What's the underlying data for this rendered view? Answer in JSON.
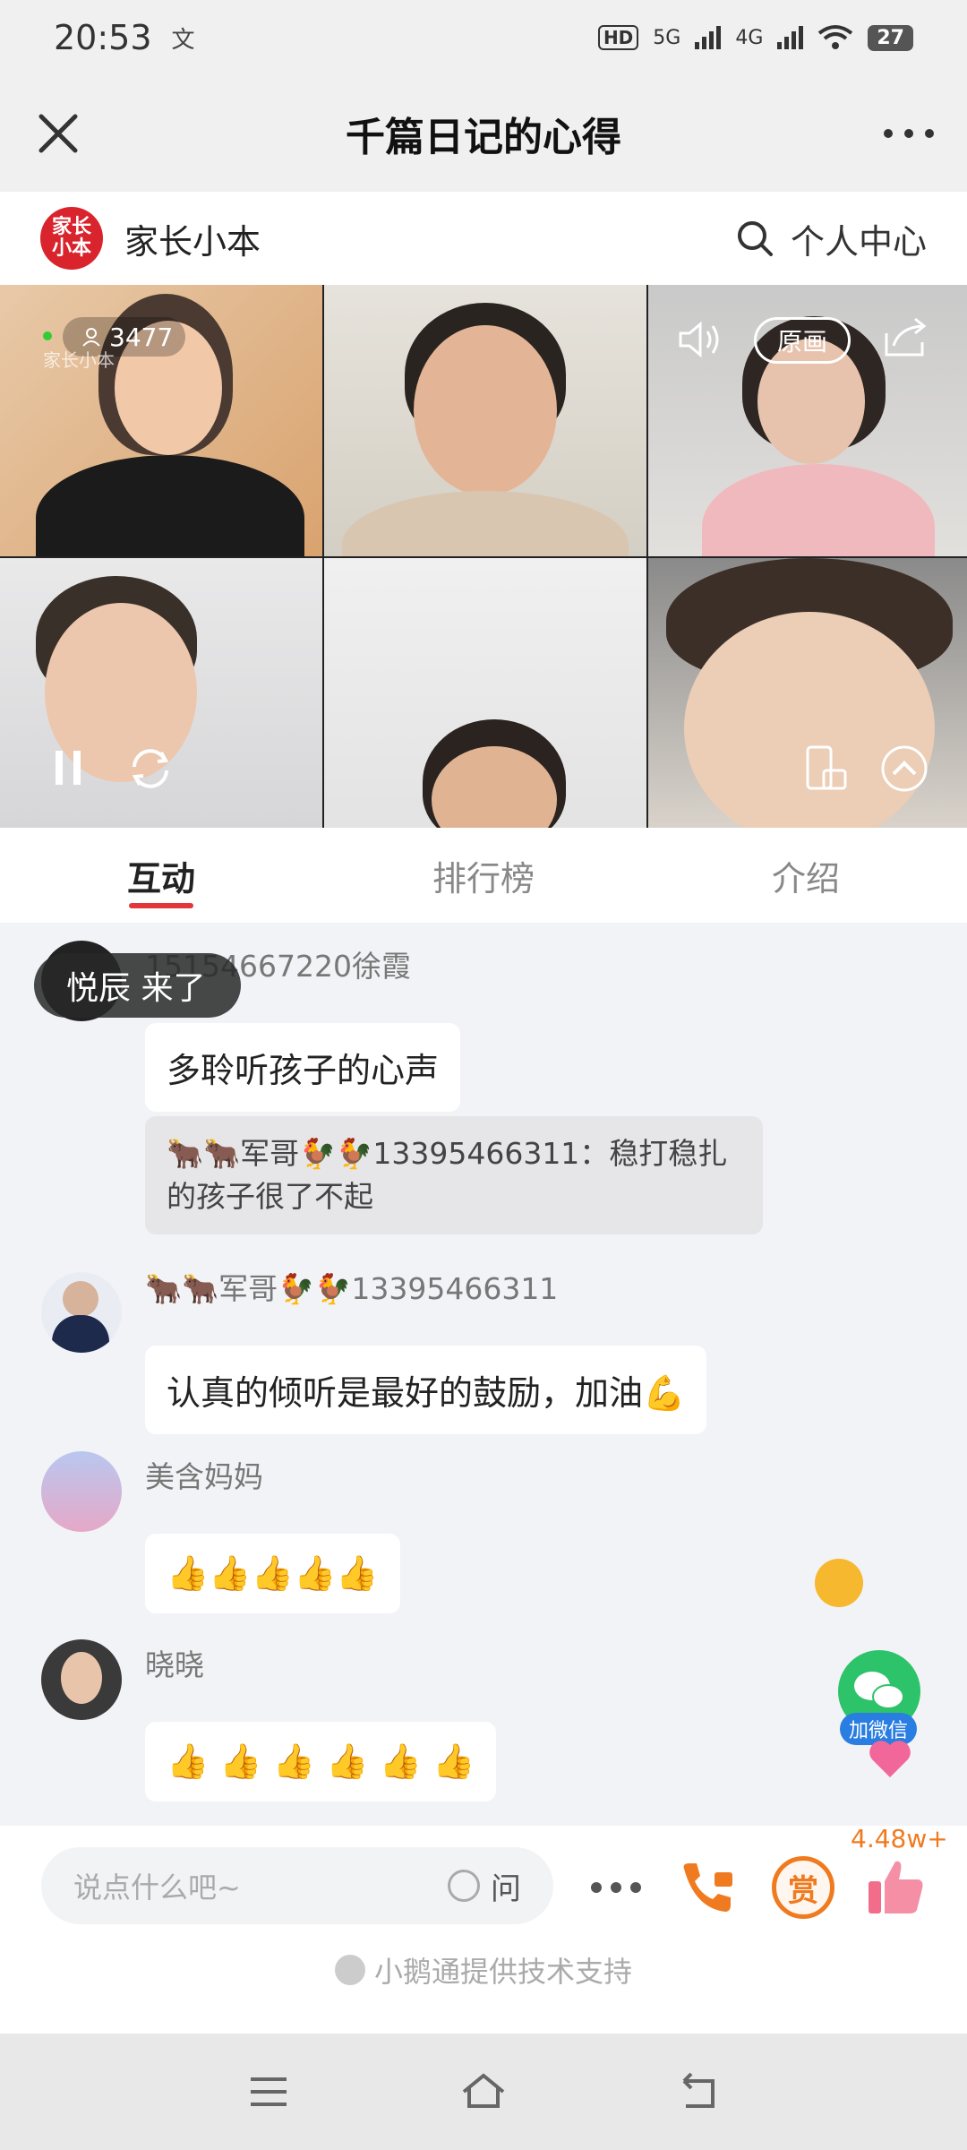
{
  "status": {
    "time": "20:53",
    "tz_icon": "文",
    "hd": "HD",
    "net1": "5G",
    "net2": "4G",
    "battery": "27"
  },
  "header": {
    "title": "千篇日记的心得"
  },
  "channel": {
    "logo_text": "家长小本",
    "name": "家长小本",
    "personal_center": "个人中心"
  },
  "live": {
    "viewers": "3477",
    "watermark": "家长小本",
    "original_label": "原画"
  },
  "tabs": [
    "互动",
    "排行榜",
    "介绍"
  ],
  "toast": {
    "text": "悦辰 来了"
  },
  "messages": [
    {
      "user": "15154667220徐霞",
      "text": "多聆听孩子的心声",
      "quote": "🐂🐂军哥🐓🐓13395466311：稳打稳扎的孩子很了不起"
    },
    {
      "user": "🐂🐂军哥🐓🐓13395466311",
      "text": "认真的倾听是最好的鼓励，加油💪"
    },
    {
      "user": "美含妈妈",
      "text": "👍👍👍👍👍"
    },
    {
      "user": "晓晓",
      "text": "👍 👍 👍 👍 👍 👍"
    }
  ],
  "wechat": {
    "label": "加微信"
  },
  "input": {
    "placeholder": "说点什么吧~",
    "ask_label": "问"
  },
  "reward": {
    "label": "赏"
  },
  "likes": {
    "count": "4.48w+"
  },
  "footer": {
    "powered_by": "小鹅通提供技术支持"
  },
  "colors": {
    "accent": "#e2363b",
    "reward": "#f07a1f",
    "wechat": "#2dc36a"
  }
}
